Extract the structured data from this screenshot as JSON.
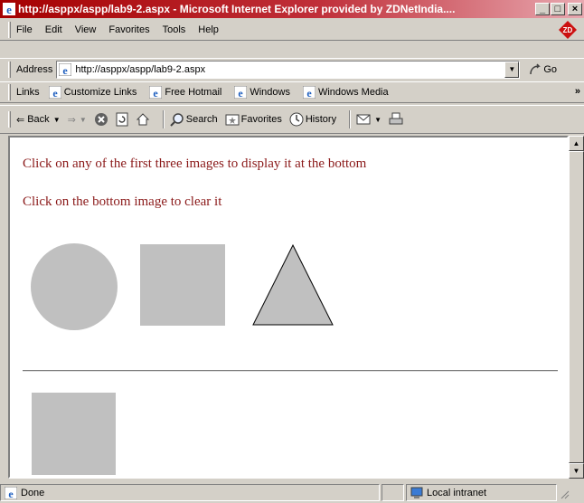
{
  "window": {
    "title": "http://asppx/aspp/lab9-2.aspx - Microsoft Internet Explorer provided by ZDNetIndia....",
    "buttons": {
      "minimize": "_",
      "maximize": "□",
      "close": "×"
    }
  },
  "menubar": {
    "items": [
      {
        "label": "File",
        "accel": "F"
      },
      {
        "label": "Edit",
        "accel": "E"
      },
      {
        "label": "View",
        "accel": "V"
      },
      {
        "label": "Favorites",
        "accel": "a"
      },
      {
        "label": "Tools",
        "accel": "T"
      },
      {
        "label": "Help",
        "accel": "H"
      }
    ],
    "brand_logo": "ZD"
  },
  "address": {
    "label": "Address",
    "value": "http://asppx/aspp/lab9-2.aspx",
    "go_label": "Go"
  },
  "links": {
    "label": "Links",
    "items": [
      "Customize Links",
      "Free Hotmail",
      "Windows",
      "Windows Media"
    ],
    "more": "»"
  },
  "toolbar": {
    "back_label": "Back",
    "search_label": "Search",
    "favorites_label": "Favorites",
    "history_label": "History"
  },
  "page": {
    "instruction_1": "Click on any of the first three images to display it at the bottom",
    "instruction_2": "Click on the bottom image to clear it",
    "text_color": "#8b1a1a",
    "shape_color": "#c0c0c0",
    "images": [
      "circle",
      "square",
      "triangle"
    ],
    "selected_image": "square"
  },
  "status": {
    "text": "Done",
    "zone": "Local intranet"
  }
}
